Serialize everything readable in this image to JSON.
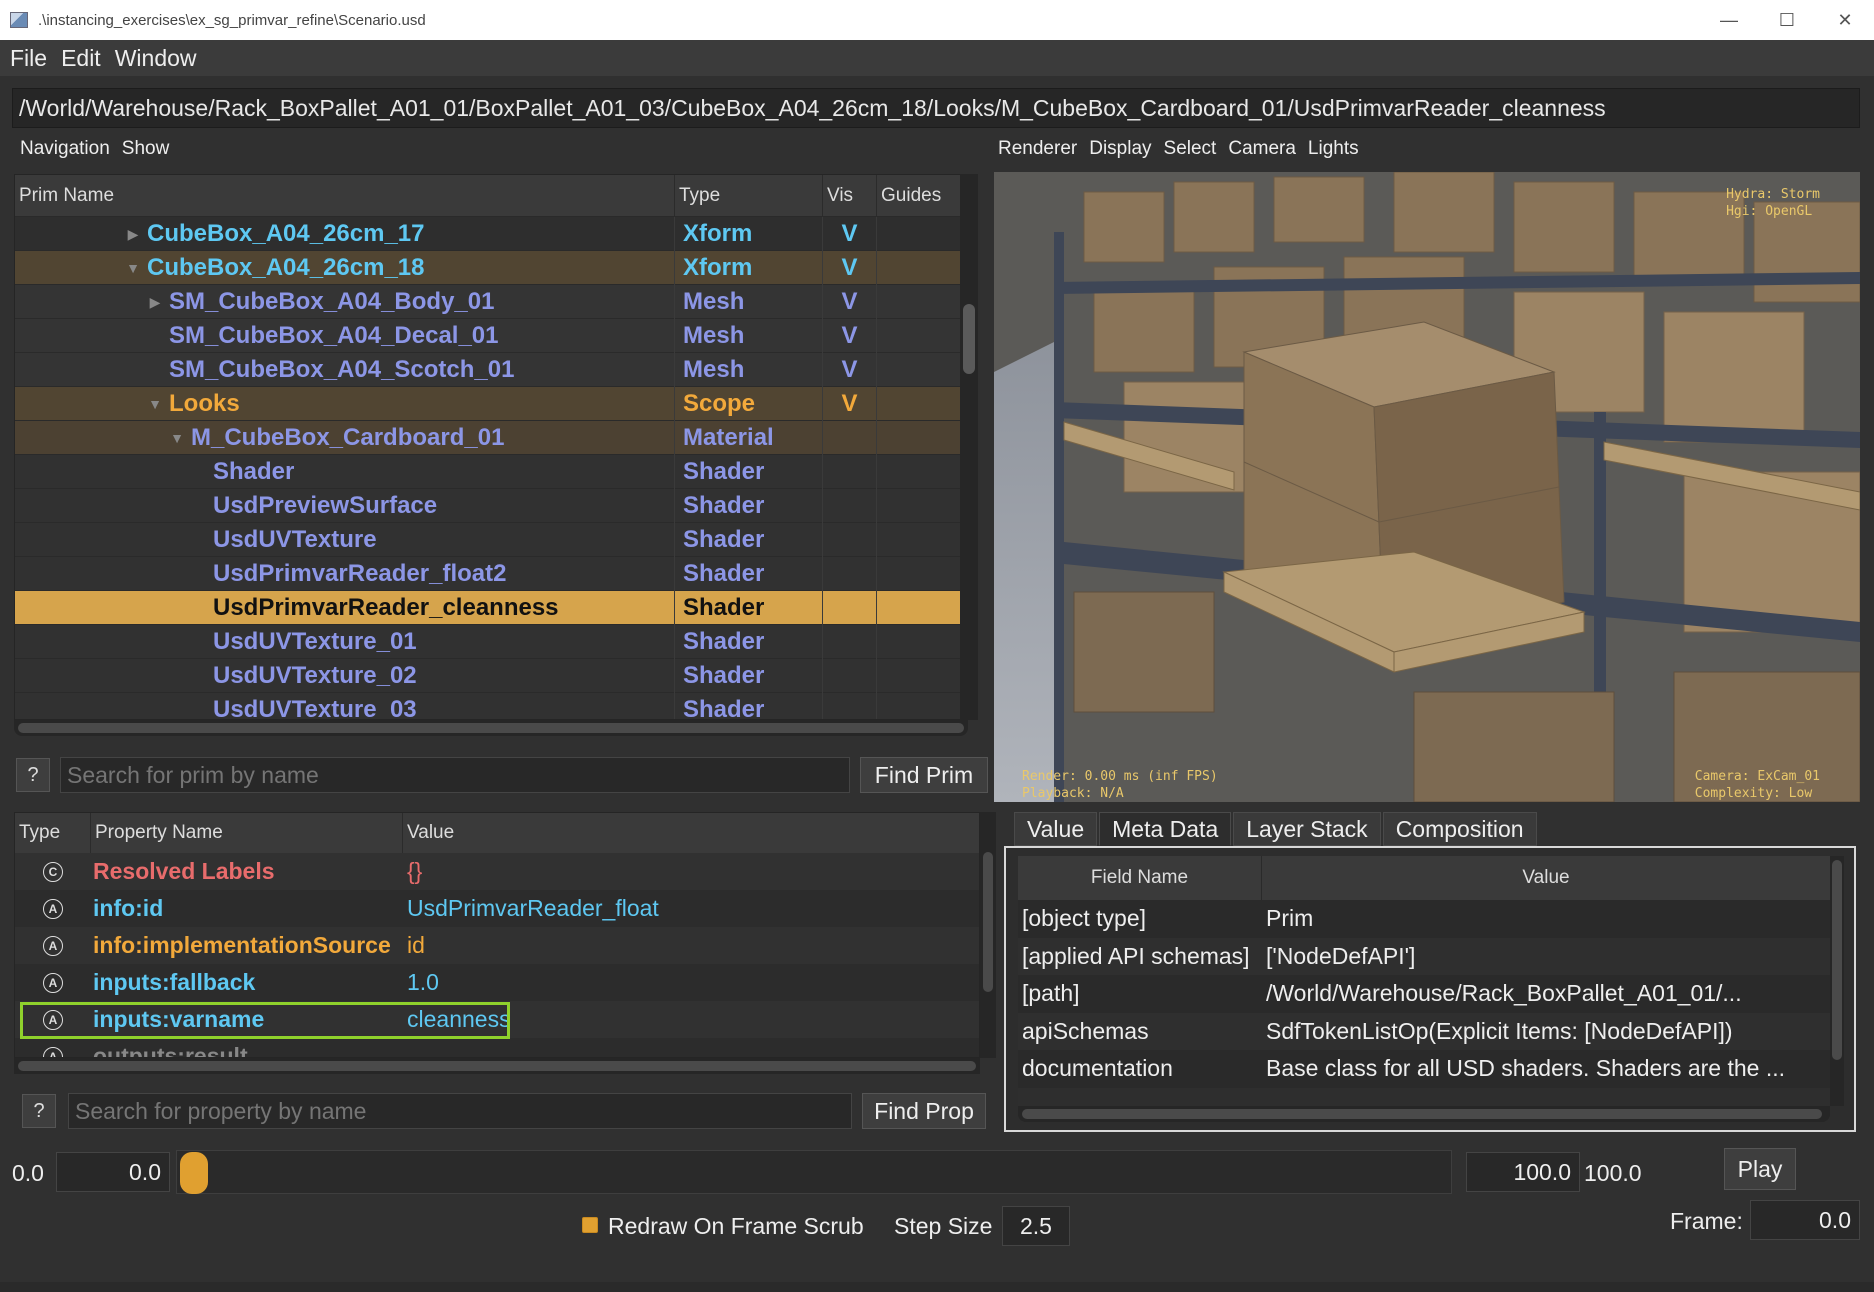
{
  "window": {
    "title": ".\\instancing_exercises\\ex_sg_primvar_refine\\Scenario.usd",
    "controls": [
      "—",
      "☐",
      "✕"
    ]
  },
  "menu": [
    "File",
    "Edit",
    "Window"
  ],
  "path": "/World/Warehouse/Rack_BoxPallet_A01_01/BoxPallet_A01_03/CubeBox_A04_26cm_18/Looks/M_CubeBox_Cardboard_01/UsdPrimvarReader_cleanness",
  "browser_toolbar": [
    "Navigation",
    "Show"
  ],
  "viewport_toolbar": [
    "Renderer",
    "Display",
    "Select",
    "Camera",
    "Lights"
  ],
  "tree": {
    "columns": [
      "Prim Name",
      "Type",
      "Vis",
      "Guides"
    ],
    "rows": [
      {
        "name": "CubeBox_A04_26cm_17",
        "type": "Xform",
        "vis": "V",
        "indent": 0,
        "arrow": "▶",
        "style": "row-xform"
      },
      {
        "name": "CubeBox_A04_26cm_18",
        "type": "Xform",
        "vis": "V",
        "indent": 0,
        "arrow": "▼",
        "style": "row-xform-sel"
      },
      {
        "name": "SM_CubeBox_A04_Body_01",
        "type": "Mesh",
        "vis": "V",
        "indent": 1,
        "arrow": "▶",
        "style": "row-mesh"
      },
      {
        "name": "SM_CubeBox_A04_Decal_01",
        "type": "Mesh",
        "vis": "V",
        "indent": 1,
        "arrow": "",
        "style": "row-mesh"
      },
      {
        "name": "SM_CubeBox_A04_Scotch_01",
        "type": "Mesh",
        "vis": "V",
        "indent": 1,
        "arrow": "",
        "style": "row-mesh"
      },
      {
        "name": "Looks",
        "type": "Scope",
        "vis": "V",
        "indent": 1,
        "arrow": "▼",
        "style": "row-scope"
      },
      {
        "name": "M_CubeBox_Cardboard_01",
        "type": "Material",
        "vis": "",
        "indent": 2,
        "arrow": "▼",
        "style": "row-material"
      },
      {
        "name": "Shader",
        "type": "Shader",
        "vis": "",
        "indent": 3,
        "arrow": "",
        "style": "row-shader"
      },
      {
        "name": "UsdPreviewSurface",
        "type": "Shader",
        "vis": "",
        "indent": 3,
        "arrow": "",
        "style": "row-shader"
      },
      {
        "name": "UsdUVTexture",
        "type": "Shader",
        "vis": "",
        "indent": 3,
        "arrow": "",
        "style": "row-shader"
      },
      {
        "name": "UsdPrimvarReader_float2",
        "type": "Shader",
        "vis": "",
        "indent": 3,
        "arrow": "",
        "style": "row-shader"
      },
      {
        "name": "UsdPrimvarReader_cleanness",
        "type": "Shader",
        "vis": "",
        "indent": 3,
        "arrow": "",
        "style": "row-selected"
      },
      {
        "name": "UsdUVTexture_01",
        "type": "Shader",
        "vis": "",
        "indent": 3,
        "arrow": "",
        "style": "row-shader"
      },
      {
        "name": "UsdUVTexture_02",
        "type": "Shader",
        "vis": "",
        "indent": 3,
        "arrow": "",
        "style": "row-shader"
      },
      {
        "name": "UsdUVTexture_03",
        "type": "Shader",
        "vis": "",
        "indent": 3,
        "arrow": "",
        "style": "row-shader"
      }
    ]
  },
  "prim_search": {
    "help": "?",
    "placeholder": "Search for prim by name",
    "button": "Find Prim"
  },
  "hud": {
    "top_right": "Hydra: Storm\nHgi: OpenGL",
    "bottom_left": "Render: 0.00 ms (inf FPS)\nPlayback: N/A",
    "bottom_right": "Camera: ExCam_01\nComplexity: Low"
  },
  "properties": {
    "columns": [
      "Type",
      "Property Name",
      "Value"
    ],
    "rows": [
      {
        "glyph": "C",
        "name": "Resolved Labels",
        "value": "{}",
        "name_color": "#e86c6c",
        "value_color": "#e86c6c"
      },
      {
        "glyph": "A",
        "name": "info:id",
        "value": "UsdPrimvarReader_float",
        "name_color": "#5ec8f2",
        "value_color": "#5ec8f2"
      },
      {
        "glyph": "A",
        "name": "info:implementationSource",
        "value": "id",
        "name_color": "#f2a93b",
        "value_color": "#f2a93b"
      },
      {
        "glyph": "A",
        "name": "inputs:fallback",
        "value": "1.0",
        "name_color": "#5ec8f2",
        "value_color": "#5ec8f2"
      },
      {
        "glyph": "A",
        "name": "inputs:varname",
        "value": "cleanness",
        "name_color": "#5ec8f2",
        "value_color": "#5ec8f2"
      },
      {
        "glyph": "A",
        "name": "outputs:result",
        "value": "",
        "name_color": "#888888",
        "value_color": "#888888"
      }
    ]
  },
  "prop_search": {
    "help": "?",
    "placeholder": "Search for property by name",
    "button": "Find Prop"
  },
  "meta": {
    "tabs": [
      "Value",
      "Meta Data",
      "Layer Stack",
      "Composition"
    ],
    "active_tab": "Meta Data",
    "columns": [
      "Field Name",
      "Value"
    ],
    "rows": [
      {
        "field": "[object type]",
        "value": "Prim"
      },
      {
        "field": "[applied API schemas]",
        "value": "['NodeDefAPI']"
      },
      {
        "field": "[path]",
        "value": "/World/Warehouse/Rack_BoxPallet_A01_01/..."
      },
      {
        "field": "apiSchemas",
        "value": "SdfTokenListOp(Explicit Items: [NodeDefAPI])"
      },
      {
        "field": "documentation",
        "value": "Base class for all USD shaders. Shaders are the ..."
      }
    ]
  },
  "timeline": {
    "start_label": "0.0",
    "start_value": "0.0",
    "end_value": "100.0",
    "end_label": "100.0",
    "play": "Play",
    "redraw_label": "Redraw On Frame Scrub",
    "step_label": "Step Size",
    "step_value": "2.5",
    "frame_label": "Frame:",
    "frame_value": "0.0"
  }
}
